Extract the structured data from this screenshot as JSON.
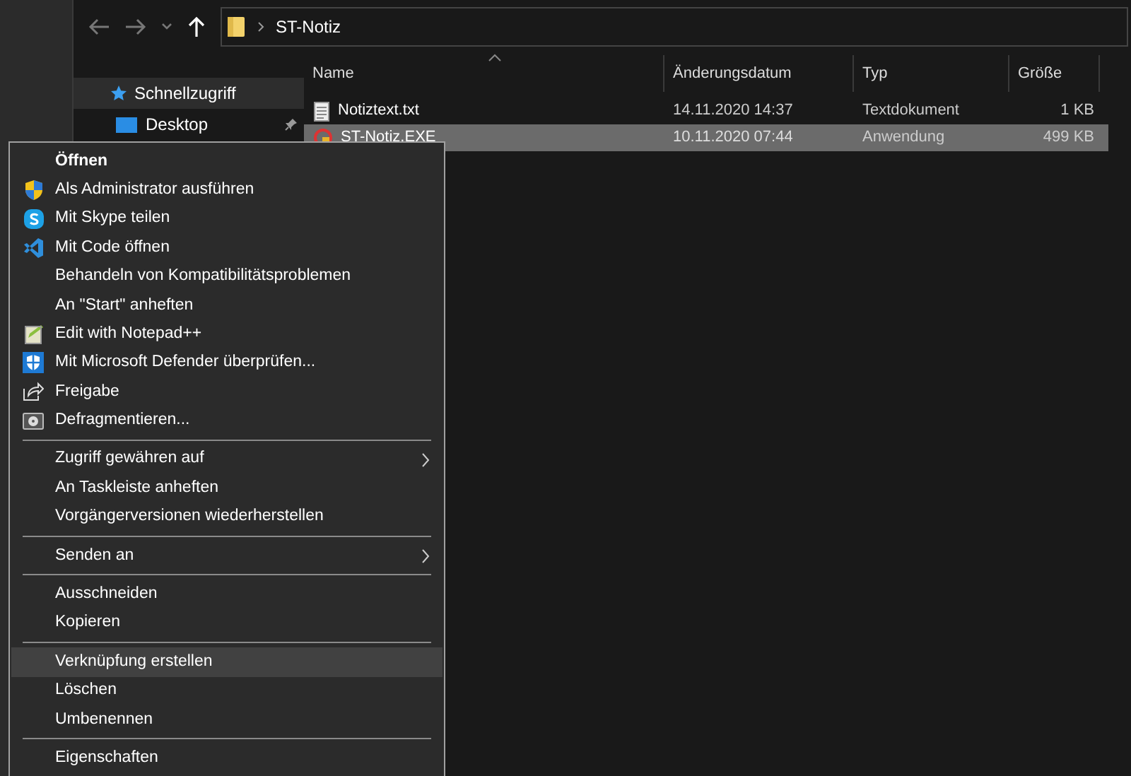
{
  "address_bar": {
    "path": "ST-Notiz"
  },
  "navigation": [
    {
      "label": "Schnellzugriff",
      "selected": true,
      "pinned": false
    },
    {
      "label": "Desktop",
      "selected": false,
      "pinned": true
    }
  ],
  "columns": [
    "Name",
    "Änderungsdatum",
    "Typ",
    "Größe"
  ],
  "files": [
    {
      "kind": "text",
      "name": "Notiztext.txt",
      "date": "14.11.2020 14:37",
      "type": "Textdokument",
      "size": "1 KB",
      "selected": false
    },
    {
      "kind": "application",
      "name": "ST-Notiz.EXE",
      "date": "10.11.2020 07:44",
      "type": "Anwendung",
      "size": "499 KB",
      "selected": true
    }
  ],
  "context_menu": [
    {
      "kind": "item",
      "label": "Öffnen",
      "default": true,
      "submenu": false,
      "selected": false
    },
    {
      "kind": "item",
      "label": "Als Administrator ausführen",
      "default": false,
      "submenu": false,
      "selected": false
    },
    {
      "kind": "item",
      "label": "Mit Skype teilen",
      "default": false,
      "submenu": false,
      "selected": false
    },
    {
      "kind": "item",
      "label": "Mit Code öffnen",
      "default": false,
      "submenu": false,
      "selected": false
    },
    {
      "kind": "item",
      "label": "Behandeln von Kompatibilitätsproblemen",
      "default": false,
      "submenu": false,
      "selected": false
    },
    {
      "kind": "item",
      "label": "An \"Start\" anheften",
      "default": false,
      "submenu": false,
      "selected": false
    },
    {
      "kind": "item",
      "label": "Edit with Notepad++",
      "default": false,
      "submenu": false,
      "selected": false
    },
    {
      "kind": "item",
      "label": "Mit Microsoft Defender überprüfen...",
      "default": false,
      "submenu": false,
      "selected": false
    },
    {
      "kind": "item",
      "label": "Freigabe",
      "default": false,
      "submenu": false,
      "selected": false
    },
    {
      "kind": "item",
      "label": "Defragmentieren...",
      "default": false,
      "submenu": false,
      "selected": false
    },
    {
      "kind": "separator"
    },
    {
      "kind": "item",
      "label": "Zugriff gewähren auf",
      "default": false,
      "submenu": true,
      "selected": false
    },
    {
      "kind": "item",
      "label": "An Taskleiste anheften",
      "default": false,
      "submenu": false,
      "selected": false
    },
    {
      "kind": "item",
      "label": "Vorgängerversionen wiederherstellen",
      "default": false,
      "submenu": false,
      "selected": false
    },
    {
      "kind": "separator"
    },
    {
      "kind": "item",
      "label": "Senden an",
      "default": false,
      "submenu": true,
      "selected": false
    },
    {
      "kind": "separator"
    },
    {
      "kind": "item",
      "label": "Ausschneiden",
      "default": false,
      "submenu": false,
      "selected": false
    },
    {
      "kind": "item",
      "label": "Kopieren",
      "default": false,
      "submenu": false,
      "selected": false
    },
    {
      "kind": "separator"
    },
    {
      "kind": "item",
      "label": "Verknüpfung erstellen",
      "default": false,
      "submenu": false,
      "selected": true
    },
    {
      "kind": "item",
      "label": "Löschen",
      "default": false,
      "submenu": false,
      "selected": false
    },
    {
      "kind": "item",
      "label": "Umbenennen",
      "default": false,
      "submenu": false,
      "selected": false
    },
    {
      "kind": "separator"
    },
    {
      "kind": "item",
      "label": "Eigenschaften",
      "default": false,
      "submenu": false,
      "selected": false
    }
  ]
}
